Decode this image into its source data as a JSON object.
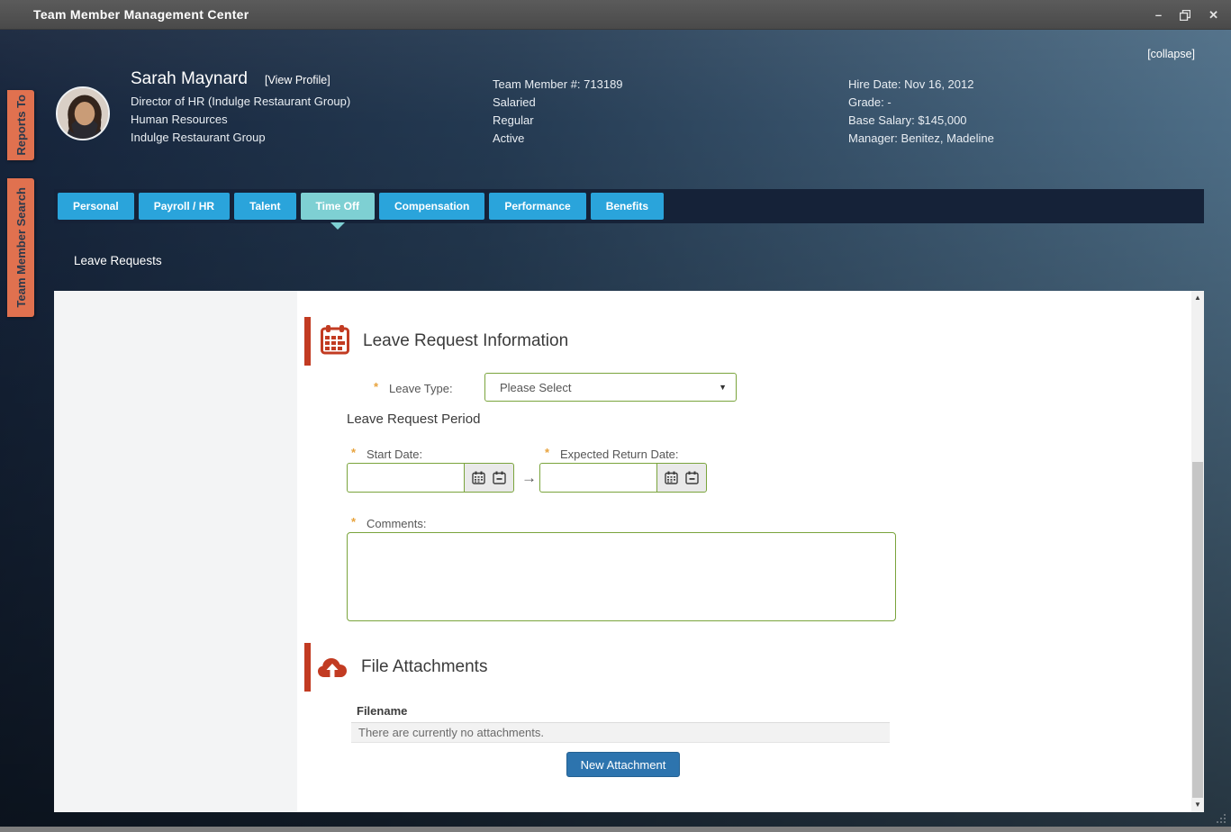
{
  "window": {
    "title": "Team Member Management Center",
    "controls": {
      "minimize": "–",
      "close": "✕"
    }
  },
  "header": {
    "collapse_label": "[collapse]",
    "employee": {
      "name": "Sarah Maynard",
      "view_profile_label": "[View Profile]",
      "job_title": "Director of HR (Indulge Restaurant Group)",
      "department": "Human Resources",
      "company": "Indulge Restaurant Group"
    },
    "middle_info": [
      "Team Member #: 713189",
      "Salaried",
      "Regular",
      "Active"
    ],
    "right_info": [
      "Hire Date: Nov 16, 2012",
      "Grade: -",
      "Base Salary: $145,000",
      "Manager: Benitez, Madeline"
    ]
  },
  "side_tabs": [
    {
      "label": "Reports To"
    },
    {
      "label": "Team Member Search"
    }
  ],
  "tabs": [
    {
      "label": "Personal",
      "active": false
    },
    {
      "label": "Payroll / HR",
      "active": false
    },
    {
      "label": "Talent",
      "active": false
    },
    {
      "label": "Time Off",
      "active": true
    },
    {
      "label": "Compensation",
      "active": false
    },
    {
      "label": "Performance",
      "active": false
    },
    {
      "label": "Benefits",
      "active": false
    }
  ],
  "breadcrumb": "Leave Requests",
  "leave_form": {
    "section_title": "Leave Request Information",
    "leave_type": {
      "required_mark": "*",
      "label": "Leave Type:",
      "value": "Please Select"
    },
    "period_title": "Leave Request Period",
    "start_date": {
      "required_mark": "*",
      "label": "Start Date:",
      "value": ""
    },
    "return_date": {
      "required_mark": "*",
      "label": "Expected Return Date:",
      "value": ""
    },
    "comments": {
      "required_mark": "*",
      "label": "Comments:",
      "value": ""
    }
  },
  "attachments": {
    "section_title": "File Attachments",
    "column_header": "Filename",
    "empty_message": "There are currently no attachments.",
    "new_button_label": "New Attachment"
  },
  "glyphs": {
    "dropdown_caret": "▼",
    "range_arrow": "→",
    "scroll_up": "▲",
    "scroll_down": "▼"
  },
  "colors": {
    "side_tab_orange": "#e0714f",
    "tab_blue": "#2aa4db",
    "tab_active_teal": "#7ed0d3",
    "section_red": "#c23b22",
    "field_border_green": "#7aa43c",
    "button_blue": "#2d74ae"
  }
}
